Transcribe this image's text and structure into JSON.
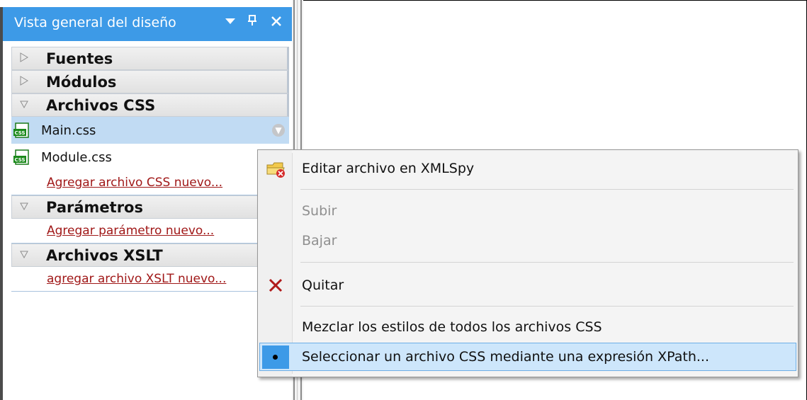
{
  "panel": {
    "title": "Vista general del diseño",
    "buttons": [
      "▼",
      "ᵖ",
      "✕"
    ],
    "groups": {
      "fuentes": "Fuentes",
      "modulos": "Módulos",
      "css": "Archivos CSS",
      "parametros": "Parámetros",
      "xslt": "Archivos XSLT"
    },
    "css_files": [
      "Main.css",
      "Module.css"
    ],
    "links": {
      "add_css": "Agregar archivo CSS nuevo...",
      "add_param": "Agregar parámetro nuevo...",
      "add_xslt": "agregar archivo XSLT nuevo..."
    }
  },
  "context_menu": {
    "items": [
      {
        "label": "Editar archivo en XMLSpy",
        "icon": "edit-folder-icon",
        "enabled": true
      },
      {
        "label": "Subir",
        "enabled": false
      },
      {
        "label": "Bajar",
        "enabled": false
      },
      {
        "label": "Quitar",
        "icon": "remove-x-icon",
        "enabled": true
      },
      {
        "label": "Mezclar los estilos de todos los archivos CSS",
        "enabled": true
      },
      {
        "label": "Seleccionar un archivo CSS mediante una expresión XPath...",
        "checked": true,
        "highlighted": true
      }
    ]
  },
  "colors": {
    "titlebar": "#3d9ae7",
    "selection": "#c1dbf3",
    "link": "#a01818",
    "menu_highlight": "#cde6fb"
  }
}
